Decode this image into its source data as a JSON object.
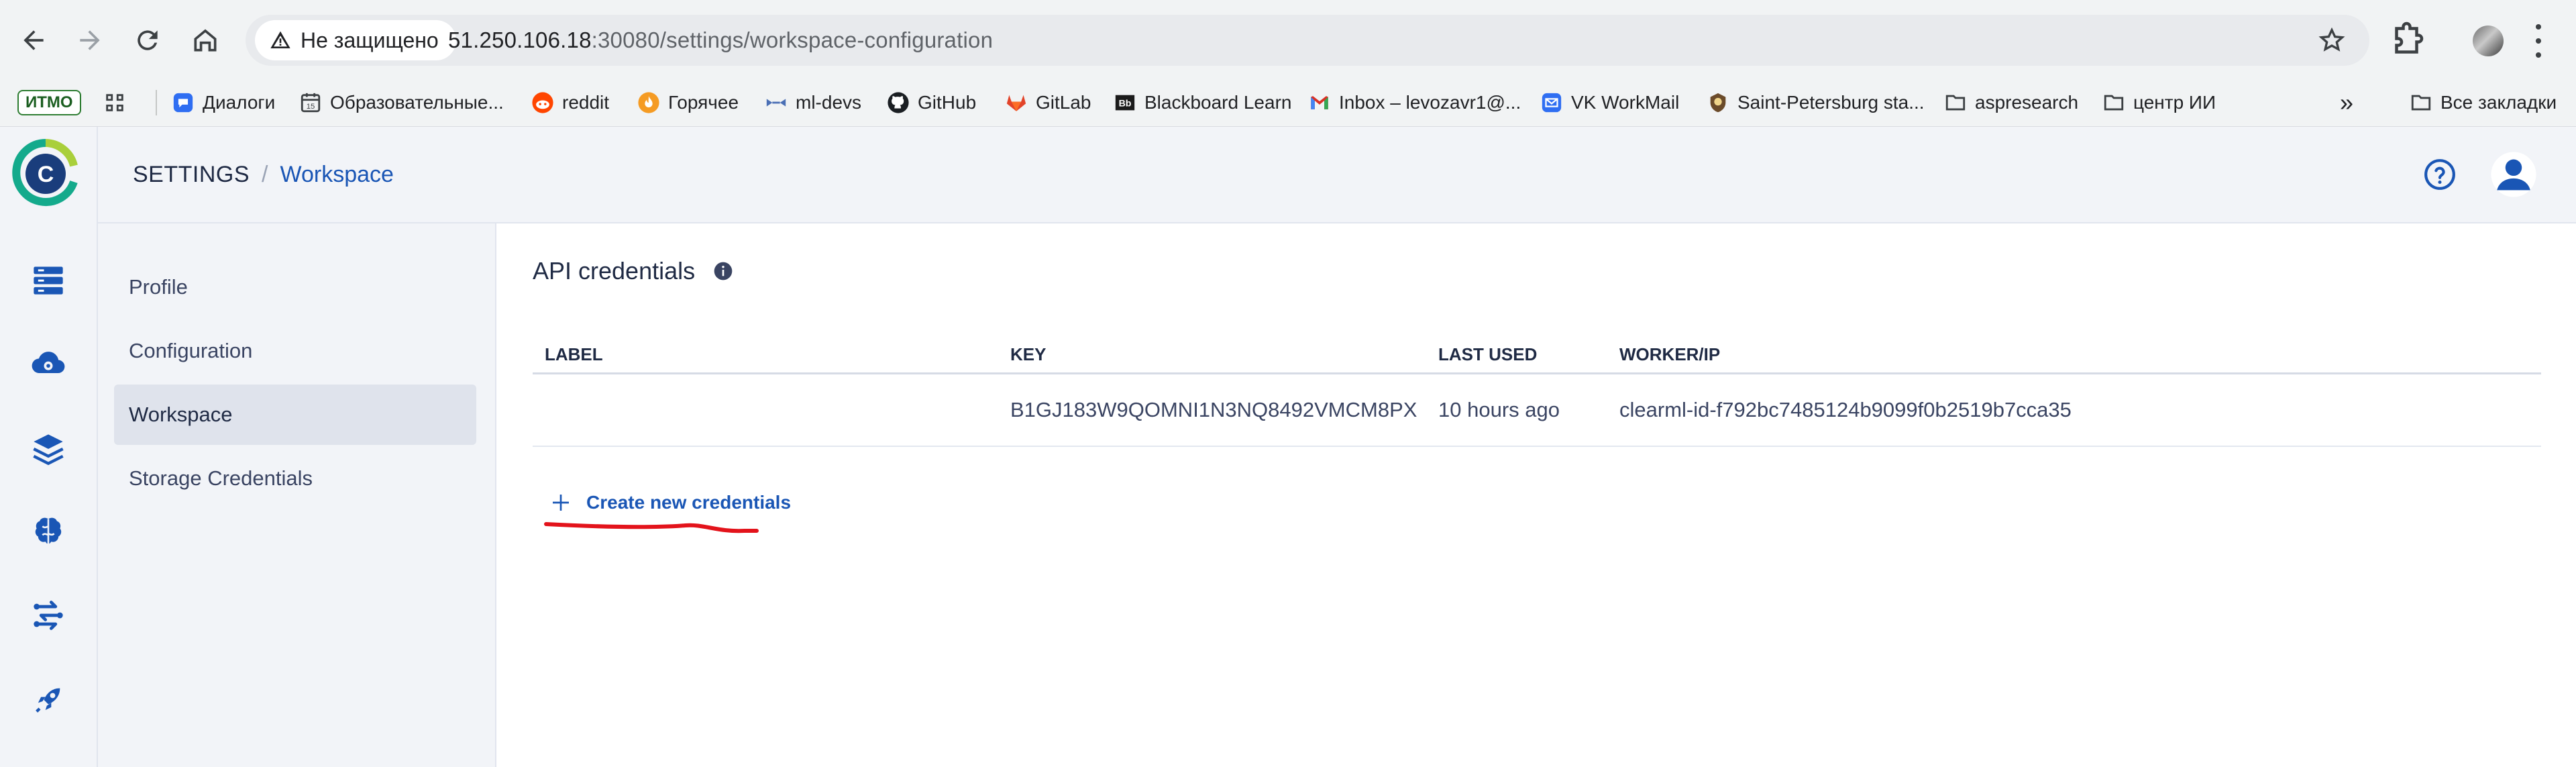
{
  "browser": {
    "security_label": "Не защищено",
    "url_host": "51.250.106.18",
    "url_rest": ":30080/settings/workspace-configuration",
    "bookmarks": [
      {
        "label": "ИТМО",
        "icon": "itmo-logo"
      },
      {
        "label": "",
        "icon": "apps-grid-icon"
      },
      {
        "label": "Диалоги",
        "icon": "chat-icon"
      },
      {
        "label": "Образовательные...",
        "icon": "calendar-icon"
      },
      {
        "label": "reddit",
        "icon": "reddit-icon"
      },
      {
        "label": "Горячее",
        "icon": "fire-icon"
      },
      {
        "label": "ml-devs",
        "icon": "ml-devs-icon"
      },
      {
        "label": "GitHub",
        "icon": "github-icon"
      },
      {
        "label": "GitLab",
        "icon": "gitlab-icon"
      },
      {
        "label": "Blackboard Learn",
        "icon": "blackboard-icon"
      },
      {
        "label": "Inbox – levozavr1@...",
        "icon": "gmail-icon"
      },
      {
        "label": "VK WorkMail",
        "icon": "mail-icon"
      },
      {
        "label": "Saint-Petersburg sta...",
        "icon": "spbu-icon"
      },
      {
        "label": "aspresearch",
        "icon": "folder-icon"
      },
      {
        "label": "центр ИИ",
        "icon": "folder-icon"
      }
    ],
    "more_bookmarks": "»",
    "all_bookmarks_label": "Все закладки"
  },
  "header": {
    "crumb_root": "SETTINGS",
    "crumb_sep": "/",
    "crumb_current": "Workspace"
  },
  "settings_nav": {
    "items": [
      {
        "label": "Profile",
        "active": false
      },
      {
        "label": "Configuration",
        "active": false
      },
      {
        "label": "Workspace",
        "active": true
      },
      {
        "label": "Storage Credentials",
        "active": false
      }
    ]
  },
  "api_credentials": {
    "title": "API credentials",
    "columns": [
      "LABEL",
      "KEY",
      "LAST USED",
      "WORKER/IP"
    ],
    "rows": [
      {
        "label": "",
        "key": "B1GJ183W9QOMNI1N3NQ8492VMCM8PX",
        "last_used": "10 hours ago",
        "worker_ip": "clearml-id-f792bc7485124b9099f0b2519b7cca35"
      }
    ],
    "create_label": "Create new credentials"
  },
  "colors": {
    "accent": "#1a56b5",
    "annotation": "#e3131b",
    "sidebar_bg": "#f2f4f8"
  }
}
